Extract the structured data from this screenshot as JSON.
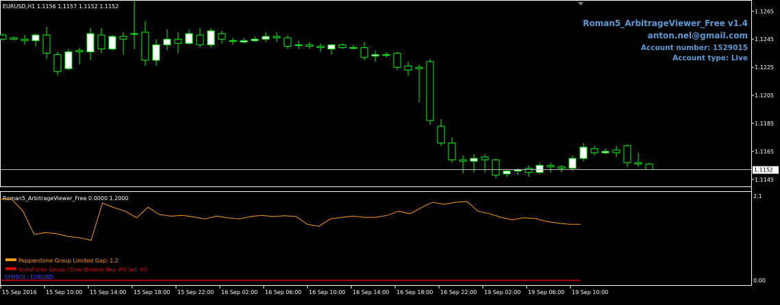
{
  "main_chart": {
    "header": "EURUSD,H1  1.1156 1.1157 1.1152 1.1152",
    "price_label": "1.1152",
    "y_ticks": [
      "1.1265",
      "1.1245",
      "1.1225",
      "1.1205",
      "1.1185",
      "1.1165",
      "1.1145"
    ],
    "ylim": [
      1.1141,
      1.1272
    ],
    "last_price": 1.1152,
    "candle_x_start": 0,
    "candle_spacing": 16,
    "colors": {
      "bull": "#ffffff",
      "bear": "#000000",
      "wick": "#00ff00",
      "axis": "#ffffff",
      "price_line": "#c0c0c0"
    }
  },
  "info_panel": {
    "title": "Roman5_ArbitrageViewer_Free v1.4",
    "email": "anton.nel@gmail.com",
    "account_number": "Account number: 1529015",
    "account_type": "Account type: Live",
    "color": "#5b9bd5"
  },
  "indicator": {
    "header": "Roman5_ArbitrageViewer_Free 0.0000 1.2000",
    "y_top_label": "2.1",
    "y_bottom_label": "0.00",
    "ylim": [
      0.0,
      2.1
    ],
    "legend": [
      {
        "label": "Pepperstone Group Limited  Gap: 1.2",
        "color": "#ff9900"
      },
      {
        "label": "InstaForex Group (Slow Broker)  Buy #0  Sell #0",
        "color": "#e00000"
      }
    ],
    "symbol_label": "SYMBOL: EURUSD",
    "symbol_color": "#4040ff"
  },
  "x_axis": {
    "labels": [
      "15 Sep 2016",
      "15 Sep 10:00",
      "15 Sep 14:00",
      "15 Sep 18:00",
      "15 Sep 22:00",
      "16 Sep 02:00",
      "16 Sep 06:00",
      "16 Sep 10:00",
      "16 Sep 14:00",
      "16 Sep 18:00",
      "16 Sep 22:00",
      "19 Sep 02:00",
      "19 Sep 06:00",
      "19 Sep 10:00"
    ]
  },
  "chart_data": [
    {
      "type": "candlestick",
      "symbol": "EURUSD",
      "timeframe": "H1",
      "series": [
        {
          "o": 1.1248,
          "h": 1.1249,
          "l": 1.1244,
          "c": 1.1245
        },
        {
          "o": 1.1246,
          "h": 1.1247,
          "l": 1.1244,
          "c": 1.1245
        },
        {
          "o": 1.1245,
          "h": 1.1248,
          "l": 1.1241,
          "c": 1.1244
        },
        {
          "o": 1.1244,
          "h": 1.1249,
          "l": 1.124,
          "c": 1.1248
        },
        {
          "o": 1.1248,
          "h": 1.1254,
          "l": 1.1231,
          "c": 1.1235
        },
        {
          "o": 1.1234,
          "h": 1.1236,
          "l": 1.1219,
          "c": 1.1222
        },
        {
          "o": 1.1224,
          "h": 1.1238,
          "l": 1.1223,
          "c": 1.1236
        },
        {
          "o": 1.1237,
          "h": 1.1239,
          "l": 1.1227,
          "c": 1.1236
        },
        {
          "o": 1.1236,
          "h": 1.1253,
          "l": 1.123,
          "c": 1.1249
        },
        {
          "o": 1.1248,
          "h": 1.1253,
          "l": 1.1235,
          "c": 1.1238
        },
        {
          "o": 1.1238,
          "h": 1.1248,
          "l": 1.1237,
          "c": 1.1247
        },
        {
          "o": 1.1247,
          "h": 1.125,
          "l": 1.1234,
          "c": 1.1245
        },
        {
          "o": 1.1249,
          "h": 1.1283,
          "l": 1.1238,
          "c": 1.1249
        },
        {
          "o": 1.125,
          "h": 1.1258,
          "l": 1.1226,
          "c": 1.123
        },
        {
          "o": 1.123,
          "h": 1.1245,
          "l": 1.1226,
          "c": 1.1241
        },
        {
          "o": 1.1241,
          "h": 1.1252,
          "l": 1.1237,
          "c": 1.1245
        },
        {
          "o": 1.1245,
          "h": 1.125,
          "l": 1.1235,
          "c": 1.1242
        },
        {
          "o": 1.1242,
          "h": 1.1252,
          "l": 1.1241,
          "c": 1.1249
        },
        {
          "o": 1.1248,
          "h": 1.1253,
          "l": 1.1239,
          "c": 1.1241
        },
        {
          "o": 1.1241,
          "h": 1.1253,
          "l": 1.1239,
          "c": 1.1251
        },
        {
          "o": 1.1249,
          "h": 1.1251,
          "l": 1.1242,
          "c": 1.1245
        },
        {
          "o": 1.1244,
          "h": 1.1246,
          "l": 1.1241,
          "c": 1.1244
        },
        {
          "o": 1.1243,
          "h": 1.1246,
          "l": 1.1242,
          "c": 1.1244
        },
        {
          "o": 1.1244,
          "h": 1.1247,
          "l": 1.1243,
          "c": 1.1245
        },
        {
          "o": 1.1245,
          "h": 1.125,
          "l": 1.1243,
          "c": 1.1247
        },
        {
          "o": 1.1247,
          "h": 1.125,
          "l": 1.1243,
          "c": 1.1246
        },
        {
          "o": 1.1246,
          "h": 1.1248,
          "l": 1.1238,
          "c": 1.124
        },
        {
          "o": 1.1241,
          "h": 1.1244,
          "l": 1.1238,
          "c": 1.1241
        },
        {
          "o": 1.1241,
          "h": 1.1243,
          "l": 1.1238,
          "c": 1.124
        },
        {
          "o": 1.124,
          "h": 1.1242,
          "l": 1.1236,
          "c": 1.1239
        },
        {
          "o": 1.1238,
          "h": 1.1242,
          "l": 1.1234,
          "c": 1.1241
        },
        {
          "o": 1.1241,
          "h": 1.1242,
          "l": 1.1238,
          "c": 1.1239
        },
        {
          "o": 1.1239,
          "h": 1.1241,
          "l": 1.1238,
          "c": 1.1239
        },
        {
          "o": 1.1239,
          "h": 1.1243,
          "l": 1.123,
          "c": 1.1232
        },
        {
          "o": 1.1233,
          "h": 1.1237,
          "l": 1.1229,
          "c": 1.1234
        },
        {
          "o": 1.1234,
          "h": 1.1236,
          "l": 1.1232,
          "c": 1.1234
        },
        {
          "o": 1.1235,
          "h": 1.1236,
          "l": 1.1223,
          "c": 1.1225
        },
        {
          "o": 1.1226,
          "h": 1.1229,
          "l": 1.1219,
          "c": 1.1223
        },
        {
          "o": 1.1225,
          "h": 1.1227,
          "l": 1.12,
          "c": 1.1224
        },
        {
          "o": 1.1229,
          "h": 1.1231,
          "l": 1.1184,
          "c": 1.1187
        },
        {
          "o": 1.1183,
          "h": 1.1188,
          "l": 1.1169,
          "c": 1.1171
        },
        {
          "o": 1.1171,
          "h": 1.1175,
          "l": 1.1157,
          "c": 1.1159
        },
        {
          "o": 1.1159,
          "h": 1.1162,
          "l": 1.1149,
          "c": 1.1158
        },
        {
          "o": 1.1158,
          "h": 1.1163,
          "l": 1.115,
          "c": 1.116
        },
        {
          "o": 1.1161,
          "h": 1.1163,
          "l": 1.115,
          "c": 1.1159
        },
        {
          "o": 1.1159,
          "h": 1.116,
          "l": 1.1146,
          "c": 1.1148
        },
        {
          "o": 1.1149,
          "h": 1.1152,
          "l": 1.1147,
          "c": 1.1151
        },
        {
          "o": 1.1151,
          "h": 1.1153,
          "l": 1.1148,
          "c": 1.1152
        },
        {
          "o": 1.1153,
          "h": 1.1155,
          "l": 1.1147,
          "c": 1.115
        },
        {
          "o": 1.115,
          "h": 1.1157,
          "l": 1.1149,
          "c": 1.1155
        },
        {
          "o": 1.1155,
          "h": 1.1157,
          "l": 1.115,
          "c": 1.1154
        },
        {
          "o": 1.1154,
          "h": 1.1155,
          "l": 1.115,
          "c": 1.1153
        },
        {
          "o": 1.1153,
          "h": 1.1162,
          "l": 1.1151,
          "c": 1.116
        },
        {
          "o": 1.116,
          "h": 1.1171,
          "l": 1.1158,
          "c": 1.1168
        },
        {
          "o": 1.1167,
          "h": 1.1169,
          "l": 1.1162,
          "c": 1.1164
        },
        {
          "o": 1.1164,
          "h": 1.1167,
          "l": 1.1163,
          "c": 1.1165
        },
        {
          "o": 1.1166,
          "h": 1.1169,
          "l": 1.1161,
          "c": 1.1164
        },
        {
          "o": 1.1169,
          "h": 1.117,
          "l": 1.1154,
          "c": 1.1157
        },
        {
          "o": 1.1157,
          "h": 1.1164,
          "l": 1.1154,
          "c": 1.1156
        },
        {
          "o": 1.1156,
          "h": 1.1157,
          "l": 1.1152,
          "c": 1.1152
        }
      ]
    },
    {
      "type": "line",
      "title": "Roman5_ArbitrageViewer_Free",
      "ylim": [
        0.0,
        2.1
      ],
      "series": [
        {
          "name": "Pepperstone Group Limited",
          "color": "#ff9900",
          "values": [
            2.01,
            2.01,
            1.72,
            1.14,
            1.19,
            1.16,
            1.09,
            1.06,
            1.0,
            1.91,
            1.8,
            1.71,
            1.55,
            1.81,
            1.63,
            1.59,
            1.61,
            1.57,
            1.52,
            1.59,
            1.55,
            1.52,
            1.58,
            1.61,
            1.58,
            1.6,
            1.58,
            1.39,
            1.34,
            1.52,
            1.56,
            1.59,
            1.56,
            1.56,
            1.61,
            1.71,
            1.65,
            1.8,
            1.93,
            1.88,
            1.93,
            1.95,
            1.71,
            1.65,
            1.56,
            1.5,
            1.55,
            1.53,
            1.46,
            1.42,
            1.39,
            1.39
          ]
        }
      ]
    }
  ]
}
